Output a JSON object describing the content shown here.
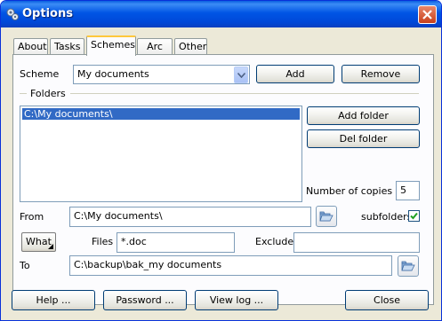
{
  "window": {
    "title": "Options"
  },
  "tabs": [
    {
      "label": "About"
    },
    {
      "label": "Tasks"
    },
    {
      "label": "Schemes",
      "active": true
    },
    {
      "label": "Arc"
    },
    {
      "label": "Other"
    }
  ],
  "scheme": {
    "label": "Scheme",
    "value": "My documents",
    "add_label": "Add",
    "remove_label": "Remove"
  },
  "folders": {
    "group_label": "Folders",
    "items": [
      "C:\\My documents\\"
    ],
    "selected_index": 0,
    "add_folder_label": "Add folder",
    "del_folder_label": "Del folder"
  },
  "copies": {
    "label": "Number of copies",
    "value": "5"
  },
  "from": {
    "label": "From",
    "value": "C:\\My documents\\",
    "subfolders_label": "subfolders",
    "subfolders_checked": true
  },
  "filter": {
    "what_label": "What",
    "files_label": "Files",
    "files_value": "*.doc",
    "exclude_label": "Exclude",
    "exclude_value": ""
  },
  "to": {
    "label": "To",
    "value": "C:\\backup\\bak_my documents"
  },
  "footer": {
    "help_label": "Help ...",
    "password_label": "Password ...",
    "viewlog_label": "View log ...",
    "close_label": "Close"
  },
  "colors": {
    "title_bar": "#0055e5",
    "selection": "#316ac5",
    "active_tab_accent": "#ffc83c",
    "dialog_bg": "#ece9d8"
  }
}
